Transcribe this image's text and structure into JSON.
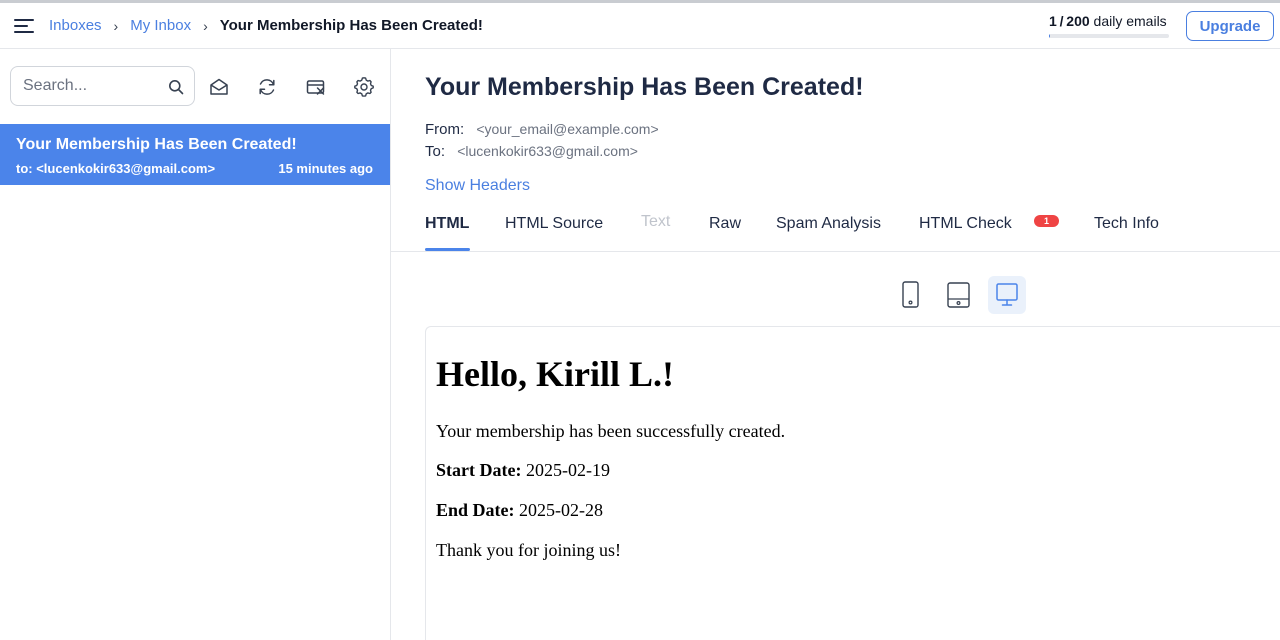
{
  "breadcrumb": {
    "inboxes": "Inboxes",
    "my_inbox": "My Inbox",
    "current": "Your Membership Has Been Created!",
    "separator": "›"
  },
  "quota": {
    "used": "1",
    "total": "200",
    "label": "daily emails",
    "fraction": 0.005
  },
  "upgrade_label": "Upgrade",
  "search": {
    "placeholder": "Search..."
  },
  "toolbar_icons": [
    "mail-open-icon",
    "refresh-icon",
    "clear-inbox-icon",
    "settings-icon"
  ],
  "inbox": {
    "items": [
      {
        "subject": "Your Membership Has Been Created!",
        "to": "to: <lucenkokir633@gmail.com>",
        "time": "15 minutes ago"
      }
    ]
  },
  "message": {
    "subject": "Your Membership Has Been Created!",
    "from_label": "From:",
    "from_value": "<your_email@example.com>",
    "to_label": "To:",
    "to_value": "<lucenkokir633@gmail.com>",
    "show_headers": "Show Headers"
  },
  "tabs": [
    {
      "label": "HTML",
      "state": "active"
    },
    {
      "label": "HTML Source",
      "state": "normal"
    },
    {
      "label": "Text",
      "state": "disabled"
    },
    {
      "label": "Raw",
      "state": "normal"
    },
    {
      "label": "Spam Analysis",
      "state": "normal"
    },
    {
      "label": "HTML Check",
      "state": "normal",
      "badge": "1"
    },
    {
      "label": "Tech Info",
      "state": "normal"
    }
  ],
  "device_views": [
    {
      "icon": "mobile-icon",
      "selected": false
    },
    {
      "icon": "tablet-icon",
      "selected": false
    },
    {
      "icon": "desktop-icon",
      "selected": true
    }
  ],
  "email_body": {
    "heading": "Hello, Kirill L.!",
    "intro": "Your membership has been successfully created.",
    "start_label": "Start Date:",
    "start_value": "2025-02-19",
    "end_label": "End Date:",
    "end_value": "2025-02-28",
    "closing": "Thank you for joining us!"
  },
  "colors": {
    "accent": "#4b84ea",
    "link": "#4a7fe0",
    "badge": "#ef4444",
    "title": "#1f2a44"
  }
}
